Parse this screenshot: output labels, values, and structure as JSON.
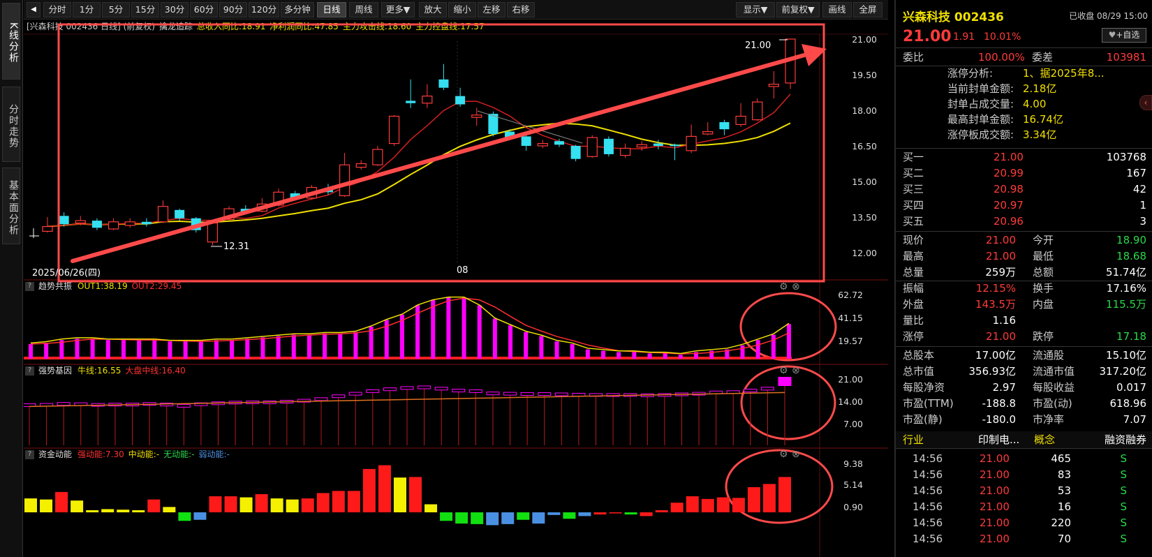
{
  "side_tabs": [
    "K线分析",
    "分时走势",
    "基本面分析"
  ],
  "toolbar": {
    "buttons": [
      "分时",
      "1分",
      "5分",
      "15分",
      "30分",
      "60分",
      "90分",
      "120分",
      "多分钟",
      "日线",
      "周线",
      "更多▼",
      "放大",
      "缩小",
      "左移",
      "右移"
    ],
    "active": "日线",
    "right_buttons": [
      "显示▼",
      "前复权▼",
      "画线",
      "全屏"
    ]
  },
  "main_chart": {
    "header": [
      {
        "text": "[兴森科技 002436 日线] (前复权)",
        "color": "#cccccc"
      },
      {
        "text": "擒龙追踪",
        "color": "#dddddd"
      },
      {
        "text": "总收入同比:18.91",
        "color": "#f0e000"
      },
      {
        "text": "净利润同比:47.85",
        "color": "#f0e000"
      },
      {
        "text": "主力攻击线:18.60",
        "color": "#f0e000"
      },
      {
        "text": "主力控盘线:17.57",
        "color": "#f0e000"
      }
    ],
    "y_ticks": [
      "21.00",
      "19.50",
      "18.00",
      "16.50",
      "15.00",
      "13.50",
      "12.00"
    ],
    "high_label": "21.00",
    "low_label": "12.31",
    "date_left": "2025/06/26(四)",
    "date_mid": "08"
  },
  "chart_data": [
    {
      "type": "candlestick",
      "title": "兴森科技 002436 日线",
      "ylim": [
        12.0,
        21.3
      ],
      "y_ticks": [
        21.0,
        19.5,
        18.0,
        16.5,
        15.0,
        13.5,
        12.0
      ],
      "candles": [
        {
          "o": 12.9,
          "c": 13.1,
          "h": 13.5,
          "l": 12.85
        },
        {
          "o": 13.55,
          "c": 13.2,
          "h": 13.7,
          "l": 13.1
        },
        {
          "o": 13.25,
          "c": 13.35,
          "h": 13.55,
          "l": 13.15
        },
        {
          "o": 13.35,
          "c": 13.05,
          "h": 13.45,
          "l": 12.95
        },
        {
          "o": 13.0,
          "c": 13.3,
          "h": 13.45,
          "l": 12.95
        },
        {
          "o": 13.15,
          "c": 13.3,
          "h": 13.45,
          "l": 13.05
        },
        {
          "o": 13.3,
          "c": 13.2,
          "h": 13.45,
          "l": 13.1
        },
        {
          "o": 13.3,
          "c": 13.95,
          "h": 14.2,
          "l": 13.25
        },
        {
          "o": 13.8,
          "c": 13.45,
          "h": 13.85,
          "l": 13.35
        },
        {
          "o": 13.45,
          "c": 12.95,
          "h": 13.5,
          "l": 12.85
        },
        {
          "o": 12.45,
          "c": 13.25,
          "h": 13.35,
          "l": 12.31
        },
        {
          "o": 13.4,
          "c": 13.85,
          "h": 13.95,
          "l": 13.35
        },
        {
          "o": 13.85,
          "c": 13.7,
          "h": 14.0,
          "l": 13.65
        },
        {
          "o": 13.75,
          "c": 14.05,
          "h": 14.3,
          "l": 13.7
        },
        {
          "o": 14.0,
          "c": 14.55,
          "h": 14.7,
          "l": 13.95
        },
        {
          "o": 14.5,
          "c": 14.25,
          "h": 14.6,
          "l": 14.2
        },
        {
          "o": 14.3,
          "c": 14.75,
          "h": 14.85,
          "l": 14.25
        },
        {
          "o": 14.65,
          "c": 14.55,
          "h": 14.9,
          "l": 14.45
        },
        {
          "o": 14.4,
          "c": 15.7,
          "h": 16.2,
          "l": 14.35
        },
        {
          "o": 15.6,
          "c": 15.75,
          "h": 15.9,
          "l": 15.5
        },
        {
          "o": 15.7,
          "c": 16.35,
          "h": 16.5,
          "l": 15.65
        },
        {
          "o": 16.6,
          "c": 17.75,
          "h": 17.8,
          "l": 16.5
        },
        {
          "o": 18.4,
          "c": 18.3,
          "h": 19.3,
          "l": 18.1
        },
        {
          "o": 18.3,
          "c": 18.6,
          "h": 19.1,
          "l": 18.1
        },
        {
          "o": 19.3,
          "c": 18.95,
          "h": 19.95,
          "l": 18.85
        },
        {
          "o": 18.6,
          "c": 18.25,
          "h": 18.95,
          "l": 18.15
        },
        {
          "o": 17.7,
          "c": 17.8,
          "h": 18.1,
          "l": 17.35
        },
        {
          "o": 17.85,
          "c": 17.0,
          "h": 17.95,
          "l": 16.9
        },
        {
          "o": 17.1,
          "c": 16.8,
          "h": 17.2,
          "l": 16.75
        },
        {
          "o": 16.9,
          "c": 16.5,
          "h": 16.95,
          "l": 16.3
        },
        {
          "o": 16.5,
          "c": 16.6,
          "h": 16.75,
          "l": 16.4
        },
        {
          "o": 16.7,
          "c": 16.55,
          "h": 16.8,
          "l": 16.45
        },
        {
          "o": 16.5,
          "c": 15.95,
          "h": 16.55,
          "l": 15.85
        },
        {
          "o": 16.05,
          "c": 16.85,
          "h": 16.95,
          "l": 16.0
        },
        {
          "o": 16.8,
          "c": 16.15,
          "h": 16.9,
          "l": 16.05
        },
        {
          "o": 16.1,
          "c": 16.4,
          "h": 16.6,
          "l": 16.0
        },
        {
          "o": 16.45,
          "c": 16.55,
          "h": 16.7,
          "l": 16.3
        },
        {
          "o": 16.6,
          "c": 16.5,
          "h": 16.75,
          "l": 16.35
        },
        {
          "o": 16.55,
          "c": 16.5,
          "h": 16.6,
          "l": 15.9
        },
        {
          "o": 16.3,
          "c": 16.9,
          "h": 17.4,
          "l": 16.2
        },
        {
          "o": 17.0,
          "c": 17.1,
          "h": 17.5,
          "l": 16.95
        },
        {
          "o": 17.5,
          "c": 17.2,
          "h": 17.6,
          "l": 16.95
        },
        {
          "o": 17.4,
          "c": 17.75,
          "h": 18.3,
          "l": 17.3
        },
        {
          "o": 17.6,
          "c": 18.35,
          "h": 18.5,
          "l": 17.55
        },
        {
          "o": 19.0,
          "c": 19.1,
          "h": 19.65,
          "l": 18.5
        },
        {
          "o": 19.15,
          "c": 21.0,
          "h": 21.0,
          "l": 18.9
        }
      ]
    },
    {
      "type": "bar",
      "title": "趋势共振",
      "series": [
        {
          "name": "OUT1",
          "last": 38.19
        },
        {
          "name": "OUT2",
          "last": 29.45
        }
      ],
      "y_ticks": [
        62.72,
        41.15,
        19.57
      ],
      "values": [
        11,
        12,
        14,
        15,
        15,
        14,
        14,
        14,
        14,
        13,
        13,
        13,
        14,
        14,
        15,
        16,
        17,
        18,
        18,
        19,
        19,
        20,
        24,
        29,
        33,
        40,
        44,
        46,
        46,
        40,
        30,
        25,
        20,
        17,
        13,
        11,
        7,
        6,
        5,
        5,
        4,
        4,
        3,
        5,
        6,
        7,
        10,
        14,
        18,
        26
      ]
    },
    {
      "type": "bar",
      "title": "强势基因",
      "series": [
        {
          "name": "牛线",
          "last": 16.55
        },
        {
          "name": "大盘中线",
          "last": 16.4
        }
      ],
      "y_ticks": [
        21.0,
        14.0,
        7.0
      ],
      "values": [
        12.4,
        12.5,
        12.8,
        12.7,
        12.5,
        12.6,
        12.6,
        12.8,
        12.6,
        12.2,
        12.7,
        13.0,
        13.2,
        13.3,
        13.3,
        13.5,
        13.8,
        14.3,
        15.2,
        16.0,
        16.8,
        17.4,
        17.8,
        18.0,
        17.6,
        17.0,
        16.8,
        16.1,
        16.0,
        15.9,
        15.9,
        15.8,
        15.7,
        15.6,
        15.6,
        15.6,
        15.5,
        15.6,
        15.8,
        16.0,
        16.4,
        16.5,
        17.0,
        17.6,
        19.2
      ]
    },
    {
      "type": "bar",
      "title": "资金动能",
      "series": [
        {
          "name": "强动能",
          "last": 7.3,
          "color": "#ff3030"
        },
        {
          "name": "中动能",
          "last": null,
          "color": "#f0e000"
        },
        {
          "name": "无动能",
          "last": null,
          "color": "#2bd84a"
        },
        {
          "name": "弱动能",
          "last": null,
          "color": "#4a90e2"
        }
      ],
      "y_ticks": [
        9.38,
        5.14,
        0.9
      ],
      "values": [
        2.6,
        2.4,
        3.8,
        2.2,
        0.4,
        0.6,
        0.5,
        0.4,
        2.4,
        1.0,
        -1.6,
        -1.4,
        3.0,
        3.0,
        2.8,
        3.4,
        2.6,
        2.4,
        2.6,
        3.6,
        4.0,
        4.0,
        8.1,
        8.8,
        6.5,
        6.6,
        1.5,
        -1.6,
        -2.1,
        -2.2,
        -2.4,
        -2.2,
        -1.4,
        -2.1,
        -0.5,
        -1.2,
        -0.7,
        -0.4,
        -0.2,
        -0.4,
        -0.7,
        0.4,
        1.8,
        3.0,
        2.5,
        2.8,
        2.7,
        4.7,
        5.3,
        6.6
      ],
      "colors": [
        "y",
        "y",
        "r",
        "y",
        "y",
        "y",
        "y",
        "y",
        "r",
        "y",
        "g",
        "b",
        "r",
        "r",
        "y",
        "r",
        "y",
        "y",
        "r",
        "r",
        "r",
        "r",
        "r",
        "r",
        "y",
        "r",
        "y",
        "g",
        "g",
        "g",
        "b",
        "b",
        "g",
        "b",
        "b",
        "g",
        "b",
        "r",
        "r",
        "g",
        "r",
        "r",
        "r",
        "r",
        "r",
        "r",
        "r",
        "r",
        "r",
        "r"
      ]
    }
  ],
  "sub_panels": {
    "p1": {
      "title": "趋势共振",
      "legend": [
        {
          "text": "OUT1:38.19",
          "color": "#f0e000"
        },
        {
          "text": "OUT2:29.45",
          "color": "#ff3030"
        }
      ],
      "y_ticks": [
        "62.72",
        "41.15",
        "19.57"
      ]
    },
    "p2": {
      "title": "强势基因",
      "legend": [
        {
          "text": "牛线:16.55",
          "color": "#f0e000"
        },
        {
          "text": "大盘中线:16.40",
          "color": "#ff3030"
        }
      ],
      "y_ticks": [
        "21.00",
        "14.00",
        "7.00"
      ]
    },
    "p3": {
      "title": "资金动能",
      "legend": [
        {
          "text": "强动能:7.30",
          "color": "#ff3030"
        },
        {
          "text": "中动能:-",
          "color": "#f0e000"
        },
        {
          "text": "无动能:-",
          "color": "#2bd84a"
        },
        {
          "text": "弱动能:-",
          "color": "#4a90e2"
        }
      ],
      "y_ticks": [
        "9.38",
        "5.14",
        "0.90"
      ]
    }
  },
  "quote": {
    "name": "兴森科技 002436",
    "status": "已收盘 08/29 15:00",
    "price": "21.00",
    "change": "1.91",
    "change_pct": "10.01%",
    "watch_button": "+自选",
    "webi_label": "委比",
    "webi_value": "100.00%",
    "weicha_label": "委差",
    "weicha_value": "103981",
    "limit_info": [
      {
        "label": "涨停分析:",
        "value": "1、据2025年8..."
      },
      {
        "label": "当前封单金额:",
        "value": "2.18亿"
      },
      {
        "label": "封单占成交量:",
        "value": "4.00"
      },
      {
        "label": "最高封单金额:",
        "value": "16.74亿"
      },
      {
        "label": "涨停板成交额:",
        "value": "3.34亿"
      }
    ],
    "bids": [
      {
        "label": "买一",
        "price": "21.00",
        "vol": "103768"
      },
      {
        "label": "买二",
        "price": "20.99",
        "vol": "167"
      },
      {
        "label": "买三",
        "price": "20.98",
        "vol": "42"
      },
      {
        "label": "买四",
        "price": "20.97",
        "vol": "1"
      },
      {
        "label": "买五",
        "price": "20.96",
        "vol": "3"
      }
    ],
    "stats": [
      [
        {
          "l": "现价",
          "v": "21.00",
          "c": "red"
        },
        {
          "l": "今开",
          "v": "18.90",
          "c": "green"
        }
      ],
      [
        {
          "l": "最高",
          "v": "21.00",
          "c": "red"
        },
        {
          "l": "最低",
          "v": "18.68",
          "c": "green"
        }
      ],
      [
        {
          "l": "总量",
          "v": "259万",
          "c": "white"
        },
        {
          "l": "总额",
          "v": "51.74亿",
          "c": "white"
        }
      ],
      [
        {
          "l": "振幅",
          "v": "12.15%",
          "c": "red"
        },
        {
          "l": "换手",
          "v": "17.16%",
          "c": "white"
        }
      ],
      [
        {
          "l": "外盘",
          "v": "143.5万",
          "c": "red"
        },
        {
          "l": "内盘",
          "v": "115.5万",
          "c": "green"
        }
      ],
      [
        {
          "l": "量比",
          "v": "1.16",
          "c": "white"
        },
        {
          "l": "",
          "v": "",
          "c": "white"
        }
      ],
      [
        {
          "l": "涨停",
          "v": "21.00",
          "c": "red"
        },
        {
          "l": "跌停",
          "v": "17.18",
          "c": "green"
        }
      ],
      [
        {
          "l": "总股本",
          "v": "17.00亿",
          "c": "white"
        },
        {
          "l": "流通股",
          "v": "15.10亿",
          "c": "white"
        }
      ],
      [
        {
          "l": "总市值",
          "v": "356.93亿",
          "c": "white"
        },
        {
          "l": "流通市值",
          "v": "317.20亿",
          "c": "white"
        }
      ],
      [
        {
          "l": "每股净资",
          "v": "2.97",
          "c": "white"
        },
        {
          "l": "每股收益",
          "v": "0.017",
          "c": "white"
        }
      ],
      [
        {
          "l": "市盈(TTM)",
          "v": "-188.8",
          "c": "white"
        },
        {
          "l": "市盈(动)",
          "v": "618.96",
          "c": "white"
        }
      ],
      [
        {
          "l": "市盈(静)",
          "v": "-180.0",
          "c": "white"
        },
        {
          "l": "市净率",
          "v": "7.07",
          "c": "white"
        }
      ]
    ],
    "info_row": [
      "行业",
      "印制电...",
      "概念",
      "融资融券"
    ],
    "ticks": [
      {
        "t": "14:56",
        "p": "21.00",
        "v": "465",
        "s": "S"
      },
      {
        "t": "14:56",
        "p": "21.00",
        "v": "83",
        "s": "S"
      },
      {
        "t": "14:56",
        "p": "21.00",
        "v": "53",
        "s": "S"
      },
      {
        "t": "14:56",
        "p": "21.00",
        "v": "16",
        "s": "S"
      },
      {
        "t": "14:56",
        "p": "21.00",
        "v": "220",
        "s": "S"
      },
      {
        "t": "14:56",
        "p": "21.00",
        "v": "70",
        "s": "S"
      }
    ]
  }
}
